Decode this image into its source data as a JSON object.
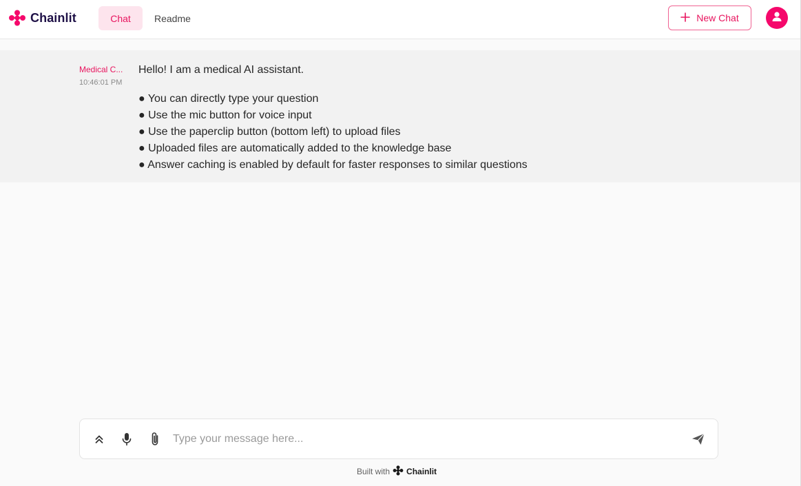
{
  "header": {
    "logo_text": "Chainlit",
    "tabs": [
      {
        "label": "Chat",
        "active": true
      },
      {
        "label": "Readme",
        "active": false
      }
    ],
    "new_chat_label": "New Chat"
  },
  "message": {
    "author": "Medical C...",
    "timestamp": "10:46:01 PM",
    "greeting": "Hello! I am a medical AI assistant.",
    "bullets": [
      "● You can directly type your question",
      "● Use the mic button for voice input",
      "● Use the paperclip button (bottom left) to upload files",
      "● Uploaded files are automatically added to the knowledge base",
      "● Answer caching is enabled by default for faster responses to similar questions"
    ]
  },
  "composer": {
    "placeholder": "Type your message here..."
  },
  "footer": {
    "built_with": "Built with",
    "brand": "Chainlit"
  },
  "icons": {
    "logo": "chainlit-logo-icon",
    "new_chat": "plus-icon",
    "avatar": "user-icon",
    "collapse": "chevrons-up-icon",
    "mic": "mic-icon",
    "attach": "paperclip-icon",
    "send": "send-icon"
  },
  "colors": {
    "accent": "#e8145e",
    "accent_bg": "#fde4ed",
    "avatar": "#f5086b",
    "message_bg": "#f2f2f2",
    "page_bg": "#fafafa"
  }
}
